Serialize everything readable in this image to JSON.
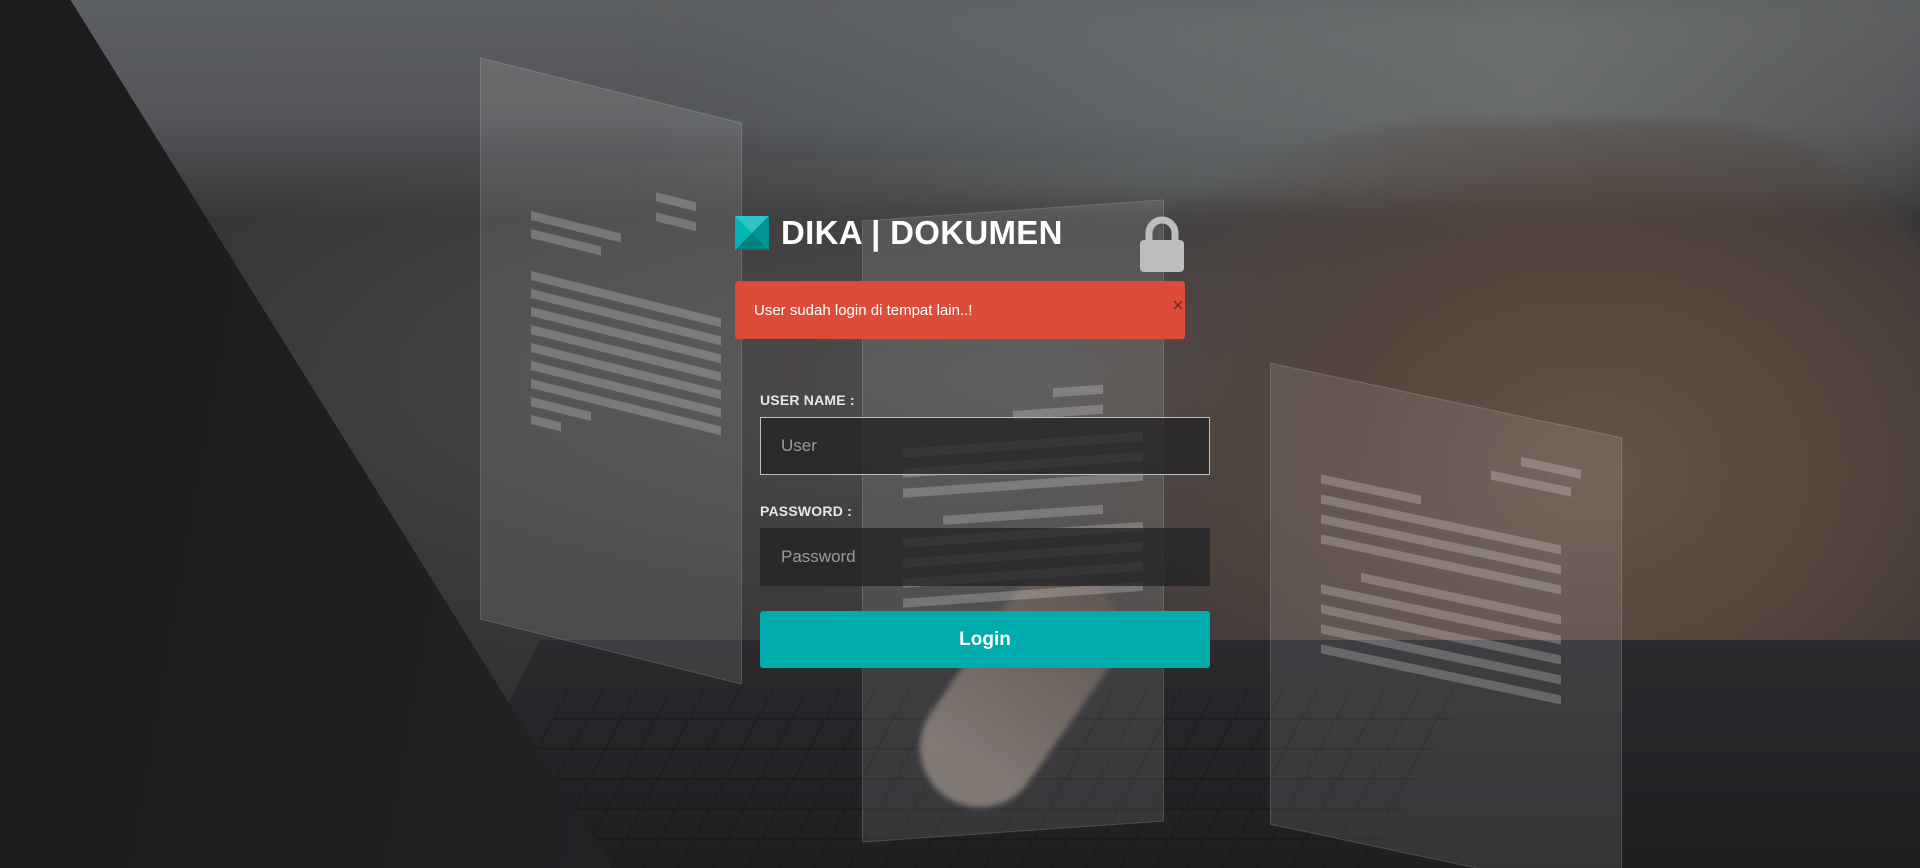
{
  "brand": {
    "title": "DIKA | DOKUMEN",
    "logo_icon": "diamond-logo-icon",
    "accent_color": "#00acac"
  },
  "header": {
    "lock_icon": "lock-icon"
  },
  "alert": {
    "message": "User sudah login di tempat lain..!",
    "close_label": "×",
    "color": "#dd4b39"
  },
  "form": {
    "username_label": "USER NAME :",
    "username_placeholder": "User",
    "username_value": "",
    "password_label": "PASSWORD :",
    "password_placeholder": "Password",
    "password_value": "",
    "login_label": "Login",
    "login_color": "#00acac"
  }
}
